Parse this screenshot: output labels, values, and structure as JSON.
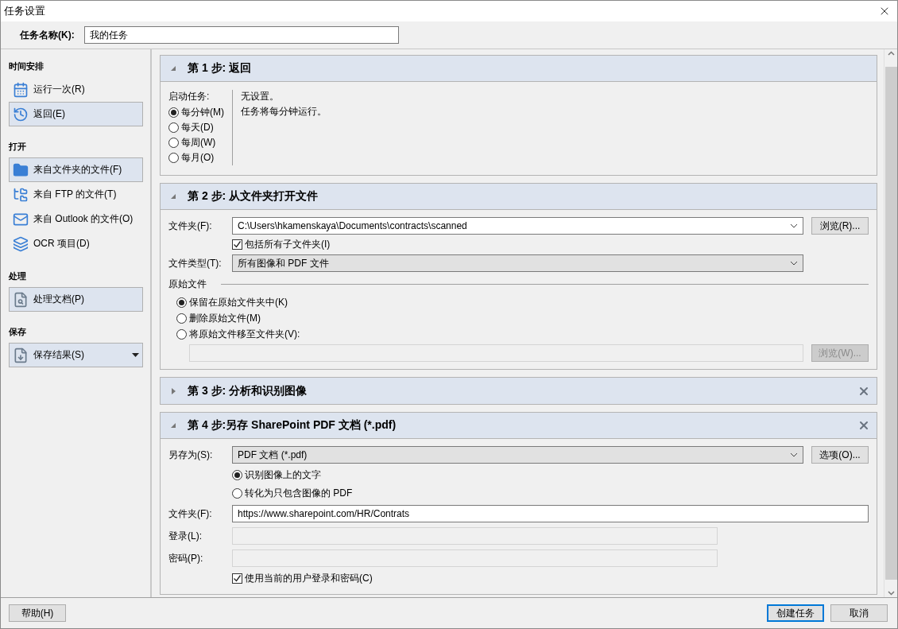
{
  "window": {
    "title": "任务设置"
  },
  "task_name": {
    "label": "任务名称(K):",
    "value": "我的任务"
  },
  "sidebar": {
    "sections": [
      {
        "title": "时间安排",
        "items": [
          {
            "label": "运行一次(R)",
            "selected": false
          },
          {
            "label": "返回(E)",
            "selected": true
          }
        ]
      },
      {
        "title": "打开",
        "items": [
          {
            "label": "来自文件夹的文件(F)",
            "selected": true
          },
          {
            "label": "来自 FTP 的文件(T)",
            "selected": false
          },
          {
            "label": "来自 Outlook 的文件(O)",
            "selected": false
          },
          {
            "label": "OCR 项目(D)",
            "selected": false
          }
        ]
      },
      {
        "title": "处理",
        "items": [
          {
            "label": "处理文档(P)",
            "selected": true
          }
        ]
      },
      {
        "title": "保存",
        "items": [
          {
            "label": "保存结果(S)",
            "selected": true,
            "dropdown": true
          }
        ]
      }
    ]
  },
  "steps": [
    {
      "kind": "schedule",
      "title": "第 1 步: 返回",
      "expanded": true,
      "closable": false,
      "start_label": "启动任务:",
      "options": [
        {
          "label": "每分钟(M)",
          "selected": true
        },
        {
          "label": "每天(D)",
          "selected": false
        },
        {
          "label": "每周(W)",
          "selected": false
        },
        {
          "label": "每月(O)",
          "selected": false
        }
      ],
      "info": [
        "无设置。",
        "任务将每分钟运行。"
      ]
    },
    {
      "kind": "open_folder",
      "title": "第 2 步: 从文件夹打开文件",
      "expanded": true,
      "closable": false,
      "folder_label": "文件夹(F):",
      "folder_value": "C:\\Users\\hkamenskaya\\Documents\\contracts\\scanned",
      "browse": "浏览(R)...",
      "include_sub": {
        "label": "包括所有子文件夹(I)",
        "checked": true
      },
      "type_label": "文件类型(T):",
      "type_value": "所有图像和 PDF 文件",
      "originals_label": "原始文件",
      "originals": [
        {
          "label": "保留在原始文件夹中(K)",
          "selected": true
        },
        {
          "label": "删除原始文件(M)",
          "selected": false
        },
        {
          "label": "将原始文件移至文件夹(V):",
          "selected": false
        }
      ],
      "move_browse": {
        "label": "浏览(W)...",
        "disabled": true
      }
    },
    {
      "kind": "analyze",
      "title": "第 3 步: 分析和识别图像",
      "expanded": false,
      "closable": true
    },
    {
      "kind": "save",
      "title": "第 4 步:另存 SharePoint PDF 文档 (*.pdf)",
      "expanded": true,
      "closable": true,
      "save_as_label": "另存为(S):",
      "save_as_value": "PDF 文档 (*.pdf)",
      "options_button": "选项(O)...",
      "modes": [
        {
          "label": "识别图像上的文字",
          "selected": true
        },
        {
          "label": "转化为只包含图像的 PDF",
          "selected": false
        }
      ],
      "folder_label": "文件夹(F):",
      "folder_value": "https://www.sharepoint.com/HR/Contrats",
      "login_label": "登录(L):",
      "password_label": "密码(P):",
      "use_current": {
        "label": "使用当前的用户登录和密码(C)",
        "checked": true
      }
    }
  ],
  "footer": {
    "help": "帮助(H)",
    "create": "创建任务",
    "cancel": "取消"
  }
}
